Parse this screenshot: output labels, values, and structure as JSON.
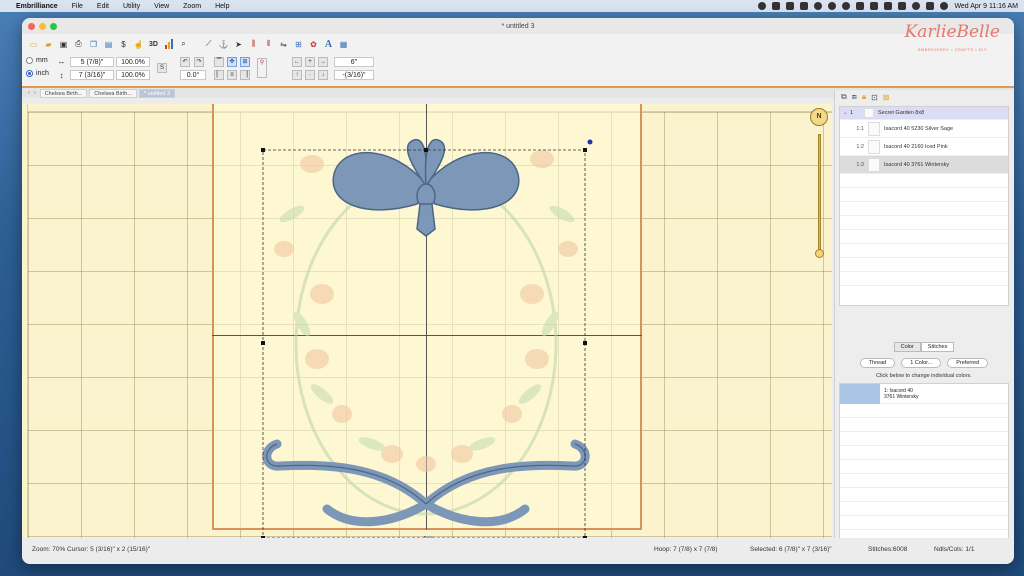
{
  "menubar": {
    "app_name": "Embrilliance",
    "menus": [
      "File",
      "Edit",
      "Utility",
      "View",
      "Zoom",
      "Help"
    ],
    "datetime": "Wed Apr 9  11:16 AM"
  },
  "window": {
    "title": "* untitled 3"
  },
  "logo": {
    "name": "KarlieBelle",
    "tagline": "EMBROIDERY • CRAFTS • DIY"
  },
  "toolbar2": {
    "unit_mm": "mm",
    "unit_inch": "inch",
    "width_value": "5 (7/8)\"",
    "height_value": "7 (3/16)\"",
    "width_scale": "100.0%",
    "height_scale": "100.0%",
    "rotation": "0.0°",
    "x_position": "6\"",
    "y_position": "-(3/16)\""
  },
  "tabs": {
    "items": [
      "Chelsea Birth...",
      "Chelsea Birth...",
      "* untitled 3"
    ]
  },
  "canvas": {
    "compass_label": "N"
  },
  "objects_panel": {
    "root": {
      "index": "1",
      "name": "Secret Garden 8x8"
    },
    "items": [
      {
        "index": "1:1",
        "name": "Isacord 40 5230 Silver Sage"
      },
      {
        "index": "1:2",
        "name": "Isacord 40 2160 Iced Pink"
      },
      {
        "index": "1:3",
        "name": "Isacord 40 3761 Wintersky"
      }
    ]
  },
  "color_panel": {
    "tab_color": "Color",
    "tab_stitches": "Stitches",
    "btn_thread": "Thread",
    "btn_one_color": "1 Color...",
    "btn_preferred": "Preferred",
    "hint": "Click below to change individual colors.",
    "colors": [
      {
        "line1": "1: Isacord 40",
        "line2": "3761 Wintersky",
        "hex": "#a9c6e6"
      }
    ]
  },
  "statusbar": {
    "zoom_cursor": "Zoom: 70%  Cursor: 5 (3/16)\" x 2 (15/16)\"",
    "hoop": "Hoop: 7 (7/8) x 7 (7/8)",
    "selected": "Selected: 6 (7/8)\" x 7 (3/16)\"",
    "stitches": "Stitches:6008",
    "ndls_cols": "Ndls/Cols: 1/1"
  },
  "colors": {
    "hoop_border": "#d8935a",
    "canvas_bg": "#fbf3cd",
    "ribbon": "#7d97b8",
    "accent_bar": "#e49a4c"
  }
}
